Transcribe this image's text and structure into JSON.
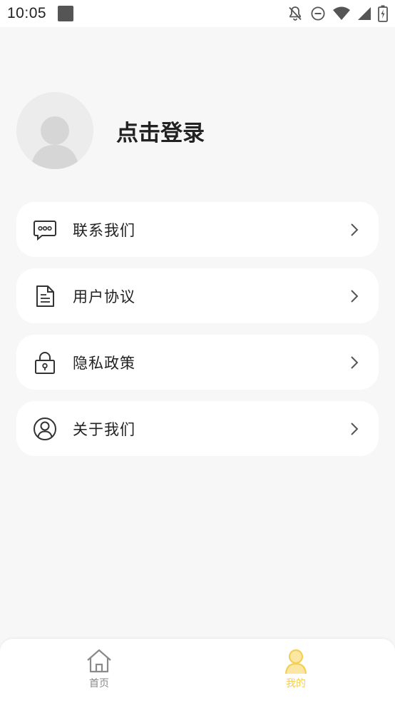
{
  "status_bar": {
    "time": "10:05",
    "icons": [
      "notifications-off-icon",
      "do-not-disturb-icon",
      "wifi-icon",
      "signal-icon",
      "battery-icon"
    ]
  },
  "profile": {
    "login_text": "点击登录",
    "avatar_icon": "default-avatar-icon"
  },
  "menu": {
    "items": [
      {
        "label": "联系我们",
        "icon": "chat-bubble-icon"
      },
      {
        "label": "用户协议",
        "icon": "document-icon"
      },
      {
        "label": "隐私政策",
        "icon": "lock-icon"
      },
      {
        "label": "关于我们",
        "icon": "person-circle-icon"
      }
    ]
  },
  "bottom_nav": {
    "tabs": [
      {
        "label": "首页",
        "icon": "home-icon",
        "active": false
      },
      {
        "label": "我的",
        "icon": "person-icon",
        "active": true
      }
    ]
  },
  "colors": {
    "background": "#f7f7f7",
    "card": "#ffffff",
    "text": "#222222",
    "accent": "#f3cf57",
    "inactive": "#8a8a8a"
  }
}
